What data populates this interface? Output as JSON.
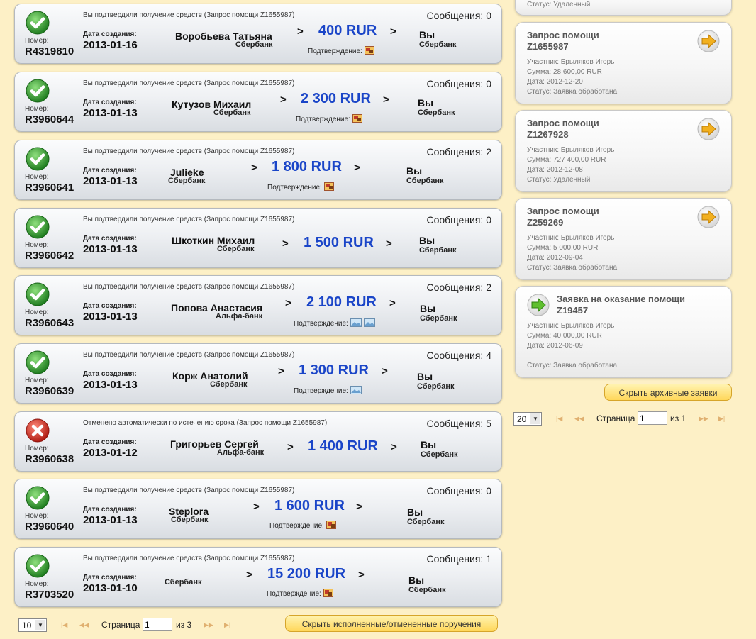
{
  "orders": [
    {
      "status": "Вы подтвердили получение средств (Запрос помощи Z1655987)",
      "messages": "Сообщения: 0",
      "number_label": "Номер:",
      "number": "R4319810",
      "date_label": "Дата создания:",
      "date": "2013-01-16",
      "sender": "Воробьева Татьяна",
      "sender_bank": "Сбербанк",
      "amount": "400 RUR",
      "recipient": "Вы",
      "recipient_bank": "Сбербанк",
      "confirm_label": "Подтверждение:",
      "state": "ok"
    },
    {
      "status": "Вы подтвердили получение средств (Запрос помощи Z1655987)",
      "messages": "Сообщения: 0",
      "number_label": "Номер:",
      "number": "R3960644",
      "date_label": "Дата создания:",
      "date": "2013-01-13",
      "sender": "Кутузов Михаил",
      "sender_bank": "Сбербанк",
      "amount": "2 300 RUR",
      "recipient": "Вы",
      "recipient_bank": "Сбербанк",
      "confirm_label": "Подтверждение:",
      "state": "ok"
    },
    {
      "status": "Вы подтвердили получение средств (Запрос помощи Z1655987)",
      "messages": "Сообщения: 2",
      "number_label": "Номер:",
      "number": "R3960641",
      "date_label": "Дата создания:",
      "date": "2013-01-13",
      "sender": "Julieke",
      "sender_bank": "Сбербанк",
      "amount": "1 800 RUR",
      "recipient": "Вы",
      "recipient_bank": "Сбербанк",
      "confirm_label": "Подтверждение:",
      "state": "ok"
    },
    {
      "status": "Вы подтвердили получение средств (Запрос помощи Z1655987)",
      "messages": "Сообщения: 0",
      "number_label": "Номер:",
      "number": "R3960642",
      "date_label": "Дата создания:",
      "date": "2013-01-13",
      "sender": "Шкоткин Михаил",
      "sender_bank": "Сбербанк",
      "amount": "1 500 RUR",
      "recipient": "Вы",
      "recipient_bank": "Сбербанк",
      "confirm_label": "",
      "state": "ok"
    },
    {
      "status": "Вы подтвердили получение средств (Запрос помощи Z1655987)",
      "messages": "Сообщения: 2",
      "number_label": "Номер:",
      "number": "R3960643",
      "date_label": "Дата создания:",
      "date": "2013-01-13",
      "sender": "Попова Анастасия",
      "sender_bank": "Альфа-банк",
      "amount": "2 100 RUR",
      "recipient": "Вы",
      "recipient_bank": "Сбербанк",
      "confirm_label": "Подтверждение:",
      "state": "ok"
    },
    {
      "status": "Вы подтвердили получение средств (Запрос помощи Z1655987)",
      "messages": "Сообщения: 4",
      "number_label": "Номер:",
      "number": "R3960639",
      "date_label": "Дата создания:",
      "date": "2013-01-13",
      "sender": "Корж Анатолий",
      "sender_bank": "Сбербанк",
      "amount": "1 300 RUR",
      "recipient": "Вы",
      "recipient_bank": "Сбербанк",
      "confirm_label": "Подтверждение:",
      "state": "ok"
    },
    {
      "status": "Отменено автоматически по истечению срока (Запрос помощи Z1655987)",
      "messages": "Сообщения: 5",
      "number_label": "Номер:",
      "number": "R3960638",
      "date_label": "Дата создания:",
      "date": "2013-01-12",
      "sender": "Григорьев Сергей",
      "sender_bank": "Альфа-банк",
      "amount": "1 400 RUR",
      "recipient": "Вы",
      "recipient_bank": "Сбербанк",
      "confirm_label": "",
      "state": "cancel"
    },
    {
      "status": "Вы подтвердили получение средств (Запрос помощи Z1655987)",
      "messages": "Сообщения: 0",
      "number_label": "Номер:",
      "number": "R3960640",
      "date_label": "Дата создания:",
      "date": "2013-01-13",
      "sender": "Steplora",
      "sender_bank": "Сбербанк",
      "amount": "1 600 RUR",
      "recipient": "Вы",
      "recipient_bank": "Сбербанк",
      "confirm_label": "Подтверждение:",
      "state": "ok"
    },
    {
      "status": "Вы подтвердили получение средств (Запрос помощи Z1655987)",
      "messages": "Сообщения: 1",
      "number_label": "Номер:",
      "number": "R3703520",
      "date_label": "Дата создания:",
      "date": "2013-01-10",
      "sender": "",
      "sender_bank": "Сбербанк",
      "amount": "15 200 RUR",
      "recipient": "Вы",
      "recipient_bank": "Сбербанк",
      "confirm_label": "Подтверждение:",
      "state": "ok"
    }
  ],
  "arrow_glyph": ">",
  "archive": {
    "top_partial": "Статус: Удаленный",
    "cards": [
      {
        "title1": "Запрос помощи",
        "title2": "Z1655987",
        "participant": "Участник: Брыляков Игорь",
        "sum": "Сумма: 28 600,00 RUR",
        "date": "Дата: 2012-12-20",
        "status": "Статус: Заявка обработана",
        "kind": "request"
      },
      {
        "title1": "Запрос помощи",
        "title2": "Z1267928",
        "participant": "Участник: Брыляков Игорь",
        "sum": "Сумма: 727 400,00 RUR",
        "date": "Дата: 2012-12-08",
        "status": "Статус: Удаленный",
        "kind": "request"
      },
      {
        "title1": "Запрос помощи",
        "title2": "Z259269",
        "participant": "Участник: Брыляков Игорь",
        "sum": "Сумма: 5 000,00 RUR",
        "date": "Дата: 2012-09-04",
        "status": "Статус: Заявка обработана",
        "kind": "request"
      },
      {
        "title1": "Заявка на оказание помощи",
        "title2": "Z19457",
        "participant": "Участник: Брыляков Игорь",
        "sum": "Сумма: 40 000,00 RUR",
        "date": "Дата: 2012-06-09",
        "status": "Статус: Заявка обработана",
        "kind": "offer"
      }
    ],
    "hide_button": "Скрыть архивные заявки",
    "pager": {
      "page_size": "20",
      "page_label": "Страница",
      "page": "1",
      "of": "из 1"
    }
  },
  "orders_pager": {
    "page_size": "10",
    "page_label": "Страница",
    "page": "1",
    "of": "из 3"
  },
  "hide_orders_button": "Скрыть исполненные/отмененные поручения",
  "colors": {
    "amount": "#1a45c8",
    "ok": "#2e8b2e",
    "cancel": "#c0281e",
    "background": "#fdf0c6",
    "button": "#ffd75a"
  }
}
